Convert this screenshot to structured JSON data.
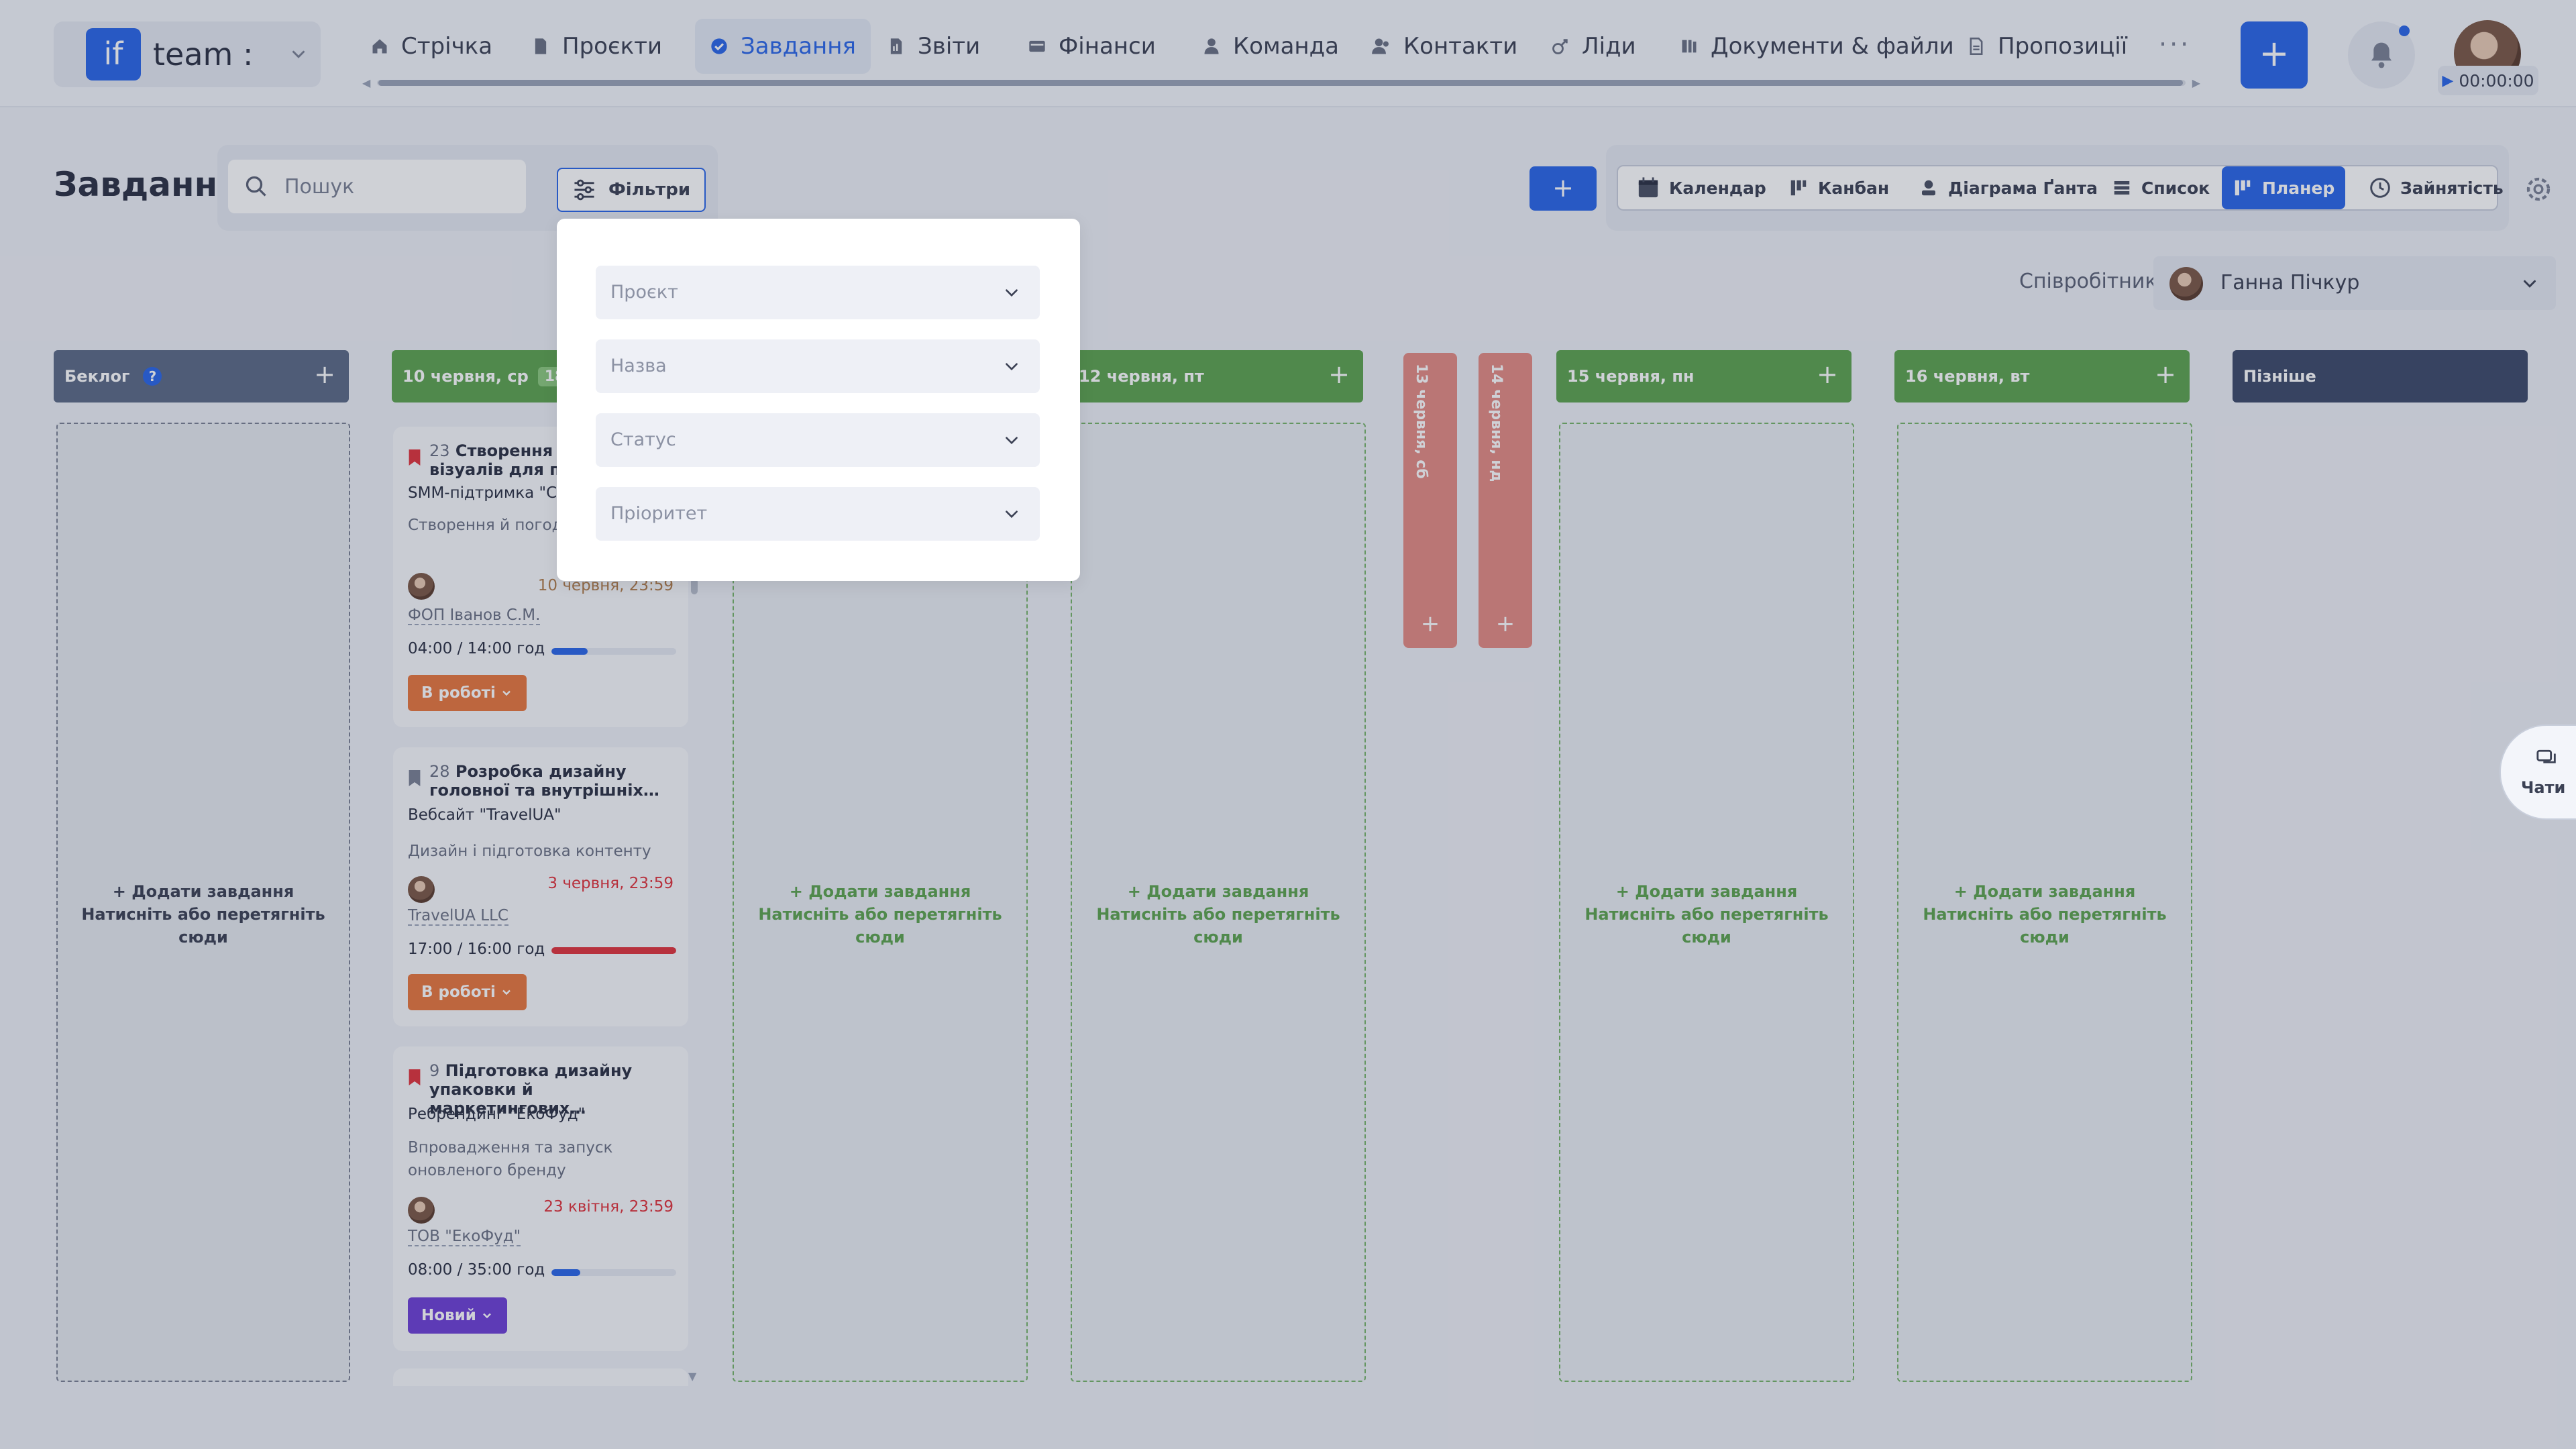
{
  "team": {
    "logo": "if",
    "name": "team :"
  },
  "nav": [
    {
      "label": "Стрічка",
      "icon": "home-icon"
    },
    {
      "label": "Проєкти",
      "icon": "file-icon"
    },
    {
      "label": "Завдання",
      "icon": "check-circle-icon",
      "active": true
    },
    {
      "label": "Звіти",
      "icon": "report-icon"
    },
    {
      "label": "Фінанси",
      "icon": "wallet-icon"
    },
    {
      "label": "Команда",
      "icon": "user-icon"
    },
    {
      "label": "Контакти",
      "icon": "contacts-icon"
    },
    {
      "label": "Ліди",
      "icon": "leads-icon"
    },
    {
      "label": "Документи & файли",
      "icon": "folder-icon"
    },
    {
      "label": "Пропозиції",
      "icon": "document-icon"
    }
  ],
  "nav_more": "···",
  "timer": "00:00:00",
  "page_title": "Завдання",
  "search_placeholder": "Пошук",
  "filters_label": "Фільтри",
  "views": [
    {
      "label": "Календар",
      "icon": "calendar-icon"
    },
    {
      "label": "Канбан",
      "icon": "kanban-icon"
    },
    {
      "label": "Діаграма Ґанта",
      "icon": "gantt-icon"
    },
    {
      "label": "Список",
      "icon": "list-icon"
    },
    {
      "label": "Планер",
      "icon": "planner-icon",
      "active": true
    },
    {
      "label": "Зайнятість",
      "icon": "clock-icon"
    }
  ],
  "employee": {
    "label": "Співробітник",
    "name": "Ганна Пічкур"
  },
  "columns": {
    "backlog": {
      "title": "Беклог",
      "help": "?"
    },
    "wed": {
      "title": "10 червня, ср",
      "count": "18"
    },
    "fri": {
      "title": "12 червня, пт"
    },
    "sat": {
      "title": "13 червня, сб"
    },
    "sun": {
      "title": "14 червня, нд"
    },
    "mon": {
      "title": "15 червня, пн"
    },
    "tue": {
      "title": "16 червня, вт"
    },
    "later": {
      "title": "Пізніше"
    }
  },
  "dropzone": {
    "add": "+ Додати завдання",
    "hint": "Натисніть або перетягніть сюди"
  },
  "cards": [
    {
      "num": "23",
      "title": "Створення те… візуалів для пуб…",
      "project": "SMM-підтримка \"Со…",
      "desc": "Створення й погод… контенту",
      "due": "10 червня, 23:59",
      "client": "ФОП Іванов С.М.",
      "time": "04:00 / 14:00 год",
      "progress": 0.29,
      "status": "В роботі"
    },
    {
      "num": "28",
      "title": "Розробка дизайну головної та внутрішніх…",
      "project": "Вебсайт \"TravelUA\"",
      "desc": "Дизайн і підготовка контенту",
      "due": "3 червня, 23:59",
      "client": "TravelUA LLC",
      "time": "17:00 / 16:00 год",
      "progress": 1.0,
      "status": "В роботі"
    },
    {
      "num": "9",
      "title": "Підготовка дизайну упаковки й маркетингових…",
      "project": "Ребрендинг \"ЕкоФуд\"",
      "desc": "Впровадження та запуск оновленого бренду",
      "due": "23 квітня, 23:59",
      "client": "ТОВ \"ЕкоФуд\"",
      "time": "08:00 / 35:00 год",
      "progress": 0.23,
      "status": "Новий"
    }
  ],
  "filter_panel": {
    "fields": [
      "Проєкт",
      "Назва",
      "Статус",
      "Пріоритет"
    ]
  },
  "chats_label": "Чати",
  "colors": {
    "accent": "#2a66e8",
    "green": "#5da34f",
    "weekend": "#e48b83",
    "status_in_progress": "#e8773d",
    "status_new": "#6e3fd6",
    "overdue": "#e0333b"
  }
}
